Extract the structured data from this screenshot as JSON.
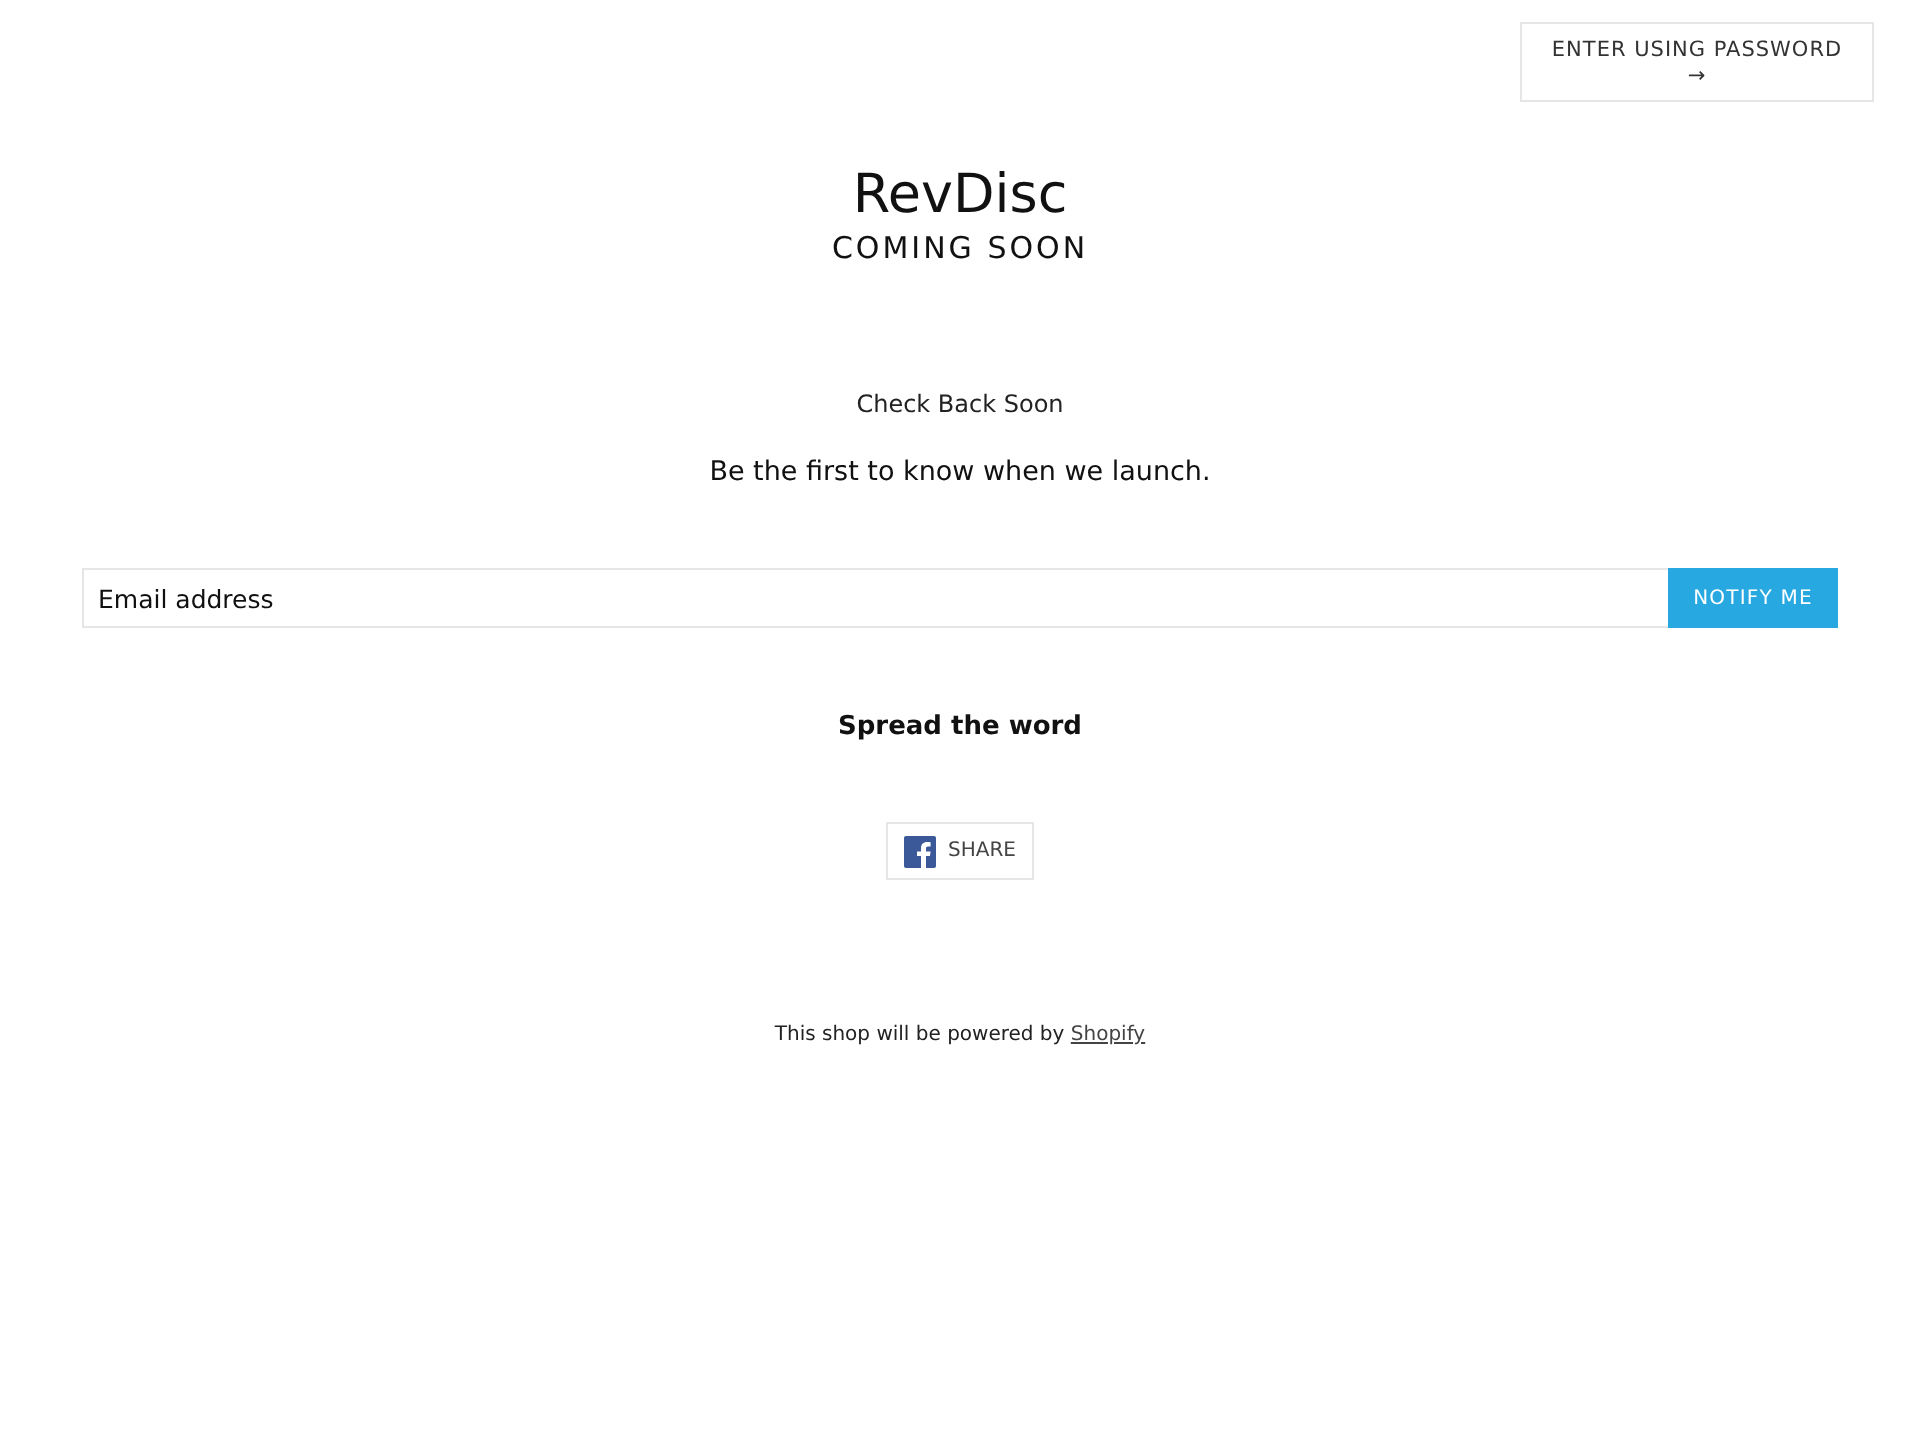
{
  "header": {
    "password_button": {
      "label": "ENTER USING PASSWORD",
      "arrow": "→"
    }
  },
  "hero": {
    "title": "RevDisc",
    "subtitle": "COMING SOON"
  },
  "message": {
    "heading": "Check Back Soon",
    "text": "Be the first to know when we launch."
  },
  "signup": {
    "email": {
      "placeholder": "Email address"
    },
    "button": "NOTIFY ME"
  },
  "share": {
    "heading": "Spread the word",
    "button": "SHARE"
  },
  "footer": {
    "text": "This shop will be powered by",
    "link": "Shopify"
  }
}
